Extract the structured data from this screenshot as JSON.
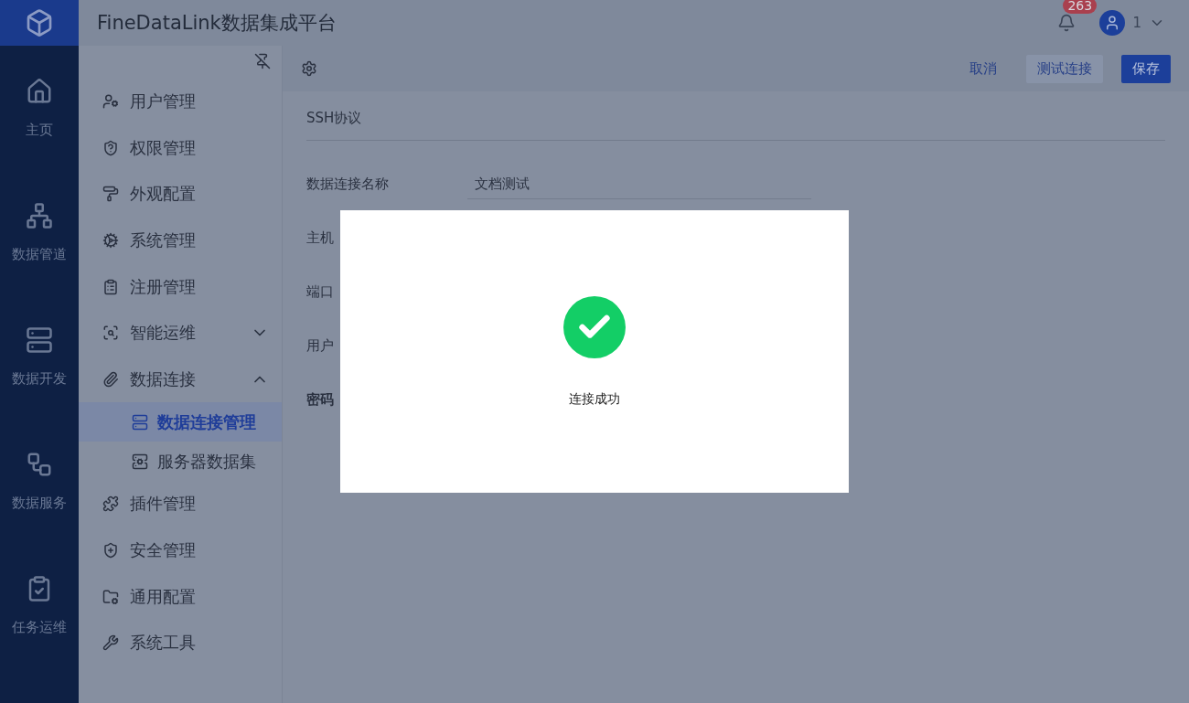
{
  "header": {
    "title": "FineDataLink数据集成平台",
    "notification_count": "263",
    "user_name": "1"
  },
  "rail": [
    {
      "label": "主页"
    },
    {
      "label": "数据管道"
    },
    {
      "label": "数据开发"
    },
    {
      "label": "数据服务"
    },
    {
      "label": "任务运维"
    }
  ],
  "sidebar": {
    "items": [
      {
        "label": "用户管理"
      },
      {
        "label": "权限管理"
      },
      {
        "label": "外观配置"
      },
      {
        "label": "系统管理"
      },
      {
        "label": "注册管理"
      },
      {
        "label": "智能运维",
        "expanded": false
      },
      {
        "label": "数据连接",
        "expanded": true,
        "children": [
          {
            "label": "数据连接管理",
            "selected": true
          },
          {
            "label": "服务器数据集",
            "selected": false
          }
        ]
      },
      {
        "label": "插件管理"
      },
      {
        "label": "安全管理"
      },
      {
        "label": "通用配置"
      },
      {
        "label": "系统工具"
      }
    ]
  },
  "toolbar": {
    "buttons": [
      {
        "label": "取消",
        "kind": "link"
      },
      {
        "label": "测试连接",
        "kind": "secondary"
      },
      {
        "label": "保存",
        "kind": "primary"
      }
    ]
  },
  "form": {
    "section_title": "SSH协议",
    "fields": [
      {
        "label": "数据连接名称",
        "value": "文档测试",
        "bold": false
      },
      {
        "label": "主机",
        "bold": false
      },
      {
        "label": "端口",
        "bold": false
      },
      {
        "label": "用户",
        "bold": false
      },
      {
        "label": "密码",
        "bold": true
      }
    ]
  },
  "dialog": {
    "message": "连接成功",
    "kind": "success"
  }
}
